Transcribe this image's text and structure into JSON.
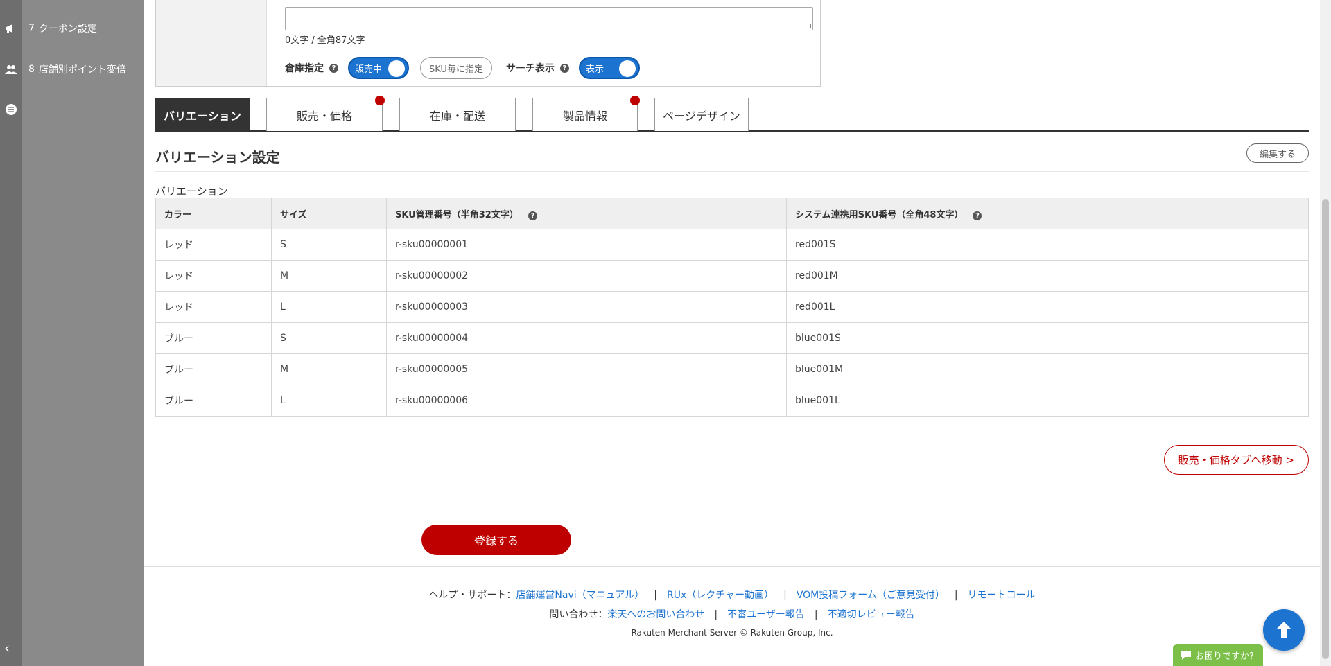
{
  "sidebar": {
    "items": [
      {
        "num": "7",
        "label": "クーポン設定",
        "icon": "megaphone-icon"
      },
      {
        "num": "8",
        "label": "店舗別ポイント変倍",
        "icon": "users-icon"
      },
      {
        "num": "",
        "label": "",
        "icon": "list-icon"
      }
    ],
    "collapse_label": "‹"
  },
  "form": {
    "char_count": "0文字 / 全角87文字",
    "warehouse_label": "倉庫指定",
    "warehouse_toggle": "販売中",
    "sku_button": "SKU毎に指定",
    "search_label": "サーチ表示",
    "search_toggle": "表示"
  },
  "tabs": [
    {
      "label": "バリエーション",
      "active": true
    },
    {
      "label": "販売・価格"
    },
    {
      "label": "在庫・配送"
    },
    {
      "label": "製品情報"
    },
    {
      "label": "ページデザイン"
    }
  ],
  "section": {
    "title": "バリエーション設定",
    "edit_button": "編集する",
    "sub_label": "バリエーション"
  },
  "table": {
    "headers": [
      "カラー",
      "サイズ",
      "SKU管理番号（半角32文字）",
      "システム連携用SKU番号（全角48文字）"
    ],
    "rows": [
      [
        "レッド",
        "S",
        "r-sku00000001",
        "red001S"
      ],
      [
        "レッド",
        "M",
        "r-sku00000002",
        "red001M"
      ],
      [
        "レッド",
        "L",
        "r-sku00000003",
        "red001L"
      ],
      [
        "ブルー",
        "S",
        "r-sku00000004",
        "blue001S"
      ],
      [
        "ブルー",
        "M",
        "r-sku00000005",
        "blue001M"
      ],
      [
        "ブルー",
        "L",
        "r-sku00000006",
        "blue001L"
      ]
    ]
  },
  "buttons": {
    "move_to_sales": "販売・価格タブへ移動 >",
    "submit": "登録する"
  },
  "footer": {
    "help_label": "ヘルプ・サポート：",
    "help_links": [
      "店舗運営Navi（マニュアル）",
      "RUx（レクチャー動画）",
      "VOM投稿フォーム（ご意見受付）",
      "リモートコール"
    ],
    "contact_label": "問い合わせ：",
    "contact_links": [
      "楽天へのお問い合わせ",
      "不審ユーザー報告",
      "不適切レビュー報告"
    ],
    "separator": "|",
    "copyright": "Rakuten Merchant Server © Rakuten Group, Inc."
  },
  "help_chip": "お困りですか?",
  "colors": {
    "accent_blue": "#1d73d0",
    "brand_red": "#bf0000",
    "chip_green": "#7cc04a"
  }
}
